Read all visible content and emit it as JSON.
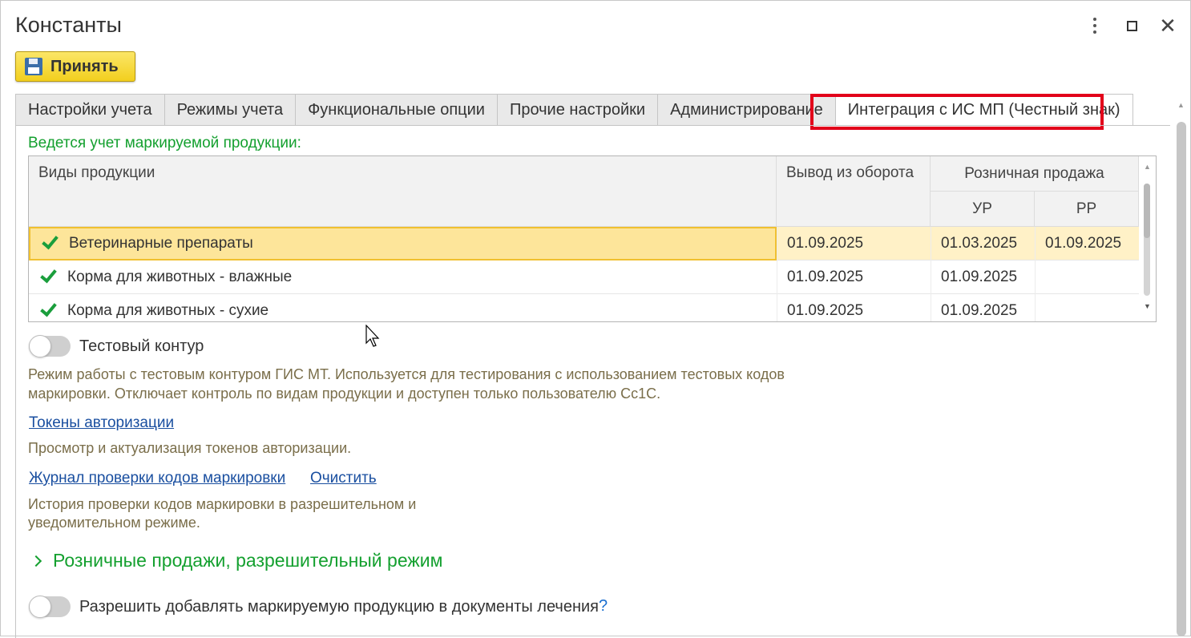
{
  "window": {
    "title": "Константы"
  },
  "toolbar": {
    "accept_label": "Принять"
  },
  "tabs": [
    {
      "label": "Настройки учета",
      "active": false
    },
    {
      "label": "Режимы учета",
      "active": false
    },
    {
      "label": "Функциональные опции",
      "active": false
    },
    {
      "label": "Прочие настройки",
      "active": false
    },
    {
      "label": "Администрирование",
      "active": false
    },
    {
      "label": "Интеграция с ИС МП (Честный знак)",
      "active": true
    }
  ],
  "marked": {
    "section_label": "Ведется учет маркируемой продукции:",
    "headers": {
      "types": "Виды продукции",
      "withdraw": "Вывод из оборота",
      "retail": "Розничная продажа",
      "ur": "УР",
      "rr": "РР"
    },
    "rows": [
      {
        "name": "Ветеринарные препараты",
        "withdraw": "01.09.2025",
        "ur": "01.03.2025",
        "rr": "01.09.2025",
        "checked": true
      },
      {
        "name": "Корма для животных - влажные",
        "withdraw": "01.09.2025",
        "ur": "01.09.2025",
        "rr": "",
        "checked": true
      },
      {
        "name": "Корма для животных - сухие",
        "withdraw": "01.09.2025",
        "ur": "01.09.2025",
        "rr": "",
        "checked": true
      }
    ]
  },
  "test_contour": {
    "label": "Тестовый контур",
    "enabled": false,
    "hint_line1": "Режим работы с тестовым контуром ГИС МТ. Используется для тестирования с использованием тестовых кодов",
    "hint_line2": "маркировки. Отключает контроль по видам продукции и доступен только пользователю Сс1С."
  },
  "tokens": {
    "link": "Токены авторизации",
    "hint": "Просмотр и актуализация токенов авторизации."
  },
  "journal": {
    "link": "Журнал проверки кодов маркировки",
    "clear_link": "Очистить",
    "hint_line1": "История проверки кодов маркировки в разрешительном и",
    "hint_line2": "уведомительном режиме."
  },
  "retail_group": {
    "title": "Розничные продажи, разрешительный режим",
    "expanded": false
  },
  "treatment": {
    "label": "Разрешить добавлять маркируемую продукцию в документы лечения",
    "enabled": false,
    "help": "?"
  },
  "colors": {
    "accent_green": "#14a02f",
    "link_blue": "#1a4fa0",
    "highlight_red": "#e2001a",
    "button_yellow": "#f2cf1e"
  }
}
